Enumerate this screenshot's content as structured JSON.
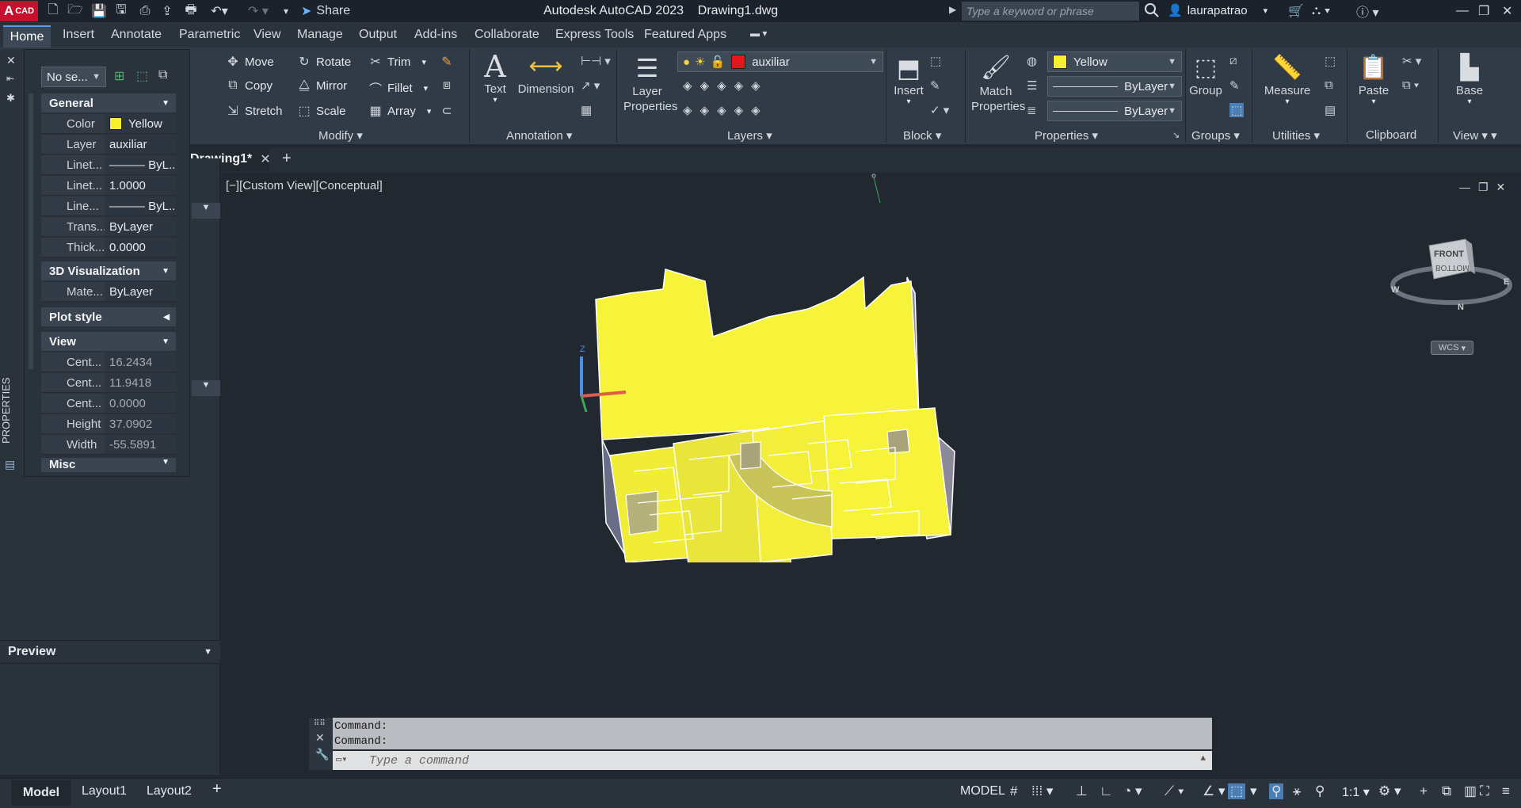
{
  "app": {
    "logo_letter": "A",
    "logo_text": "CAD",
    "title": "Autodesk AutoCAD 2023    Drawing1.dwg",
    "share_label": "Share",
    "search_placeholder": "Type a keyword or phrase",
    "username": "laurapatrao"
  },
  "ribbon_tabs": [
    "Home",
    "Insert",
    "Annotate",
    "Parametric",
    "View",
    "Manage",
    "Output",
    "Add-ins",
    "Collaborate",
    "Express Tools",
    "Featured Apps"
  ],
  "modify": {
    "move": "Move",
    "rotate": "Rotate",
    "trim": "Trim",
    "copy": "Copy",
    "mirror": "Mirror",
    "fillet": "Fillet",
    "stretch": "Stretch",
    "scale": "Scale",
    "array": "Array",
    "title": "Modify"
  },
  "annotation": {
    "text": "Text",
    "dimension": "Dimension",
    "title": "Annotation"
  },
  "layers": {
    "props_line1": "Layer",
    "props_line2": "Properties",
    "current_layer": "auxiliar",
    "layer_color": "#e8141b",
    "title": "Layers"
  },
  "block": {
    "insert": "Insert",
    "title": "Block"
  },
  "properties": {
    "match_line1": "Match",
    "match_line2": "Properties",
    "color_value": "Yellow",
    "color_hex": "#f6f12a",
    "linetype": "ByLayer",
    "lineweight": "ByLayer",
    "title": "Properties"
  },
  "groups": {
    "group": "Group",
    "title": "Groups"
  },
  "utilities": {
    "measure": "Measure",
    "title": "Utilities"
  },
  "clipboard": {
    "paste": "Paste",
    "title": "Clipboard"
  },
  "view_panel": {
    "base": "Base",
    "title": "View"
  },
  "doc_tab": "Drawing1*",
  "viewport_label": "[−][Custom View][Conceptual]",
  "viewcube": {
    "face_top": "FRONT",
    "face_bottom": "BOTTOM",
    "compass_w": "W",
    "compass_e": "E",
    "compass_n": "N",
    "wcs": "WCS"
  },
  "palette": {
    "selection": "No se...",
    "side_title": "PROPERTIES",
    "categories": {
      "general": "General",
      "viz": "3D Visualization",
      "plot": "Plot style",
      "view": "View",
      "misc": "Misc"
    },
    "general_rows": [
      {
        "k": "Color",
        "v": "Yellow"
      },
      {
        "k": "Layer",
        "v": "auxiliar"
      },
      {
        "k": "Linet...",
        "v": "——— ByL..."
      },
      {
        "k": "Linet...",
        "v": "1.0000"
      },
      {
        "k": "Line...",
        "v": "——— ByL..."
      },
      {
        "k": "Trans...",
        "v": "ByLayer"
      },
      {
        "k": "Thick...",
        "v": "0.0000"
      }
    ],
    "viz_rows": [
      {
        "k": "Mate...",
        "v": "ByLayer"
      }
    ],
    "view_rows": [
      {
        "k": "Cent...",
        "v": "16.2434"
      },
      {
        "k": "Cent...",
        "v": "11.9418"
      },
      {
        "k": "Cent...",
        "v": "0.0000"
      },
      {
        "k": "Height",
        "v": "37.0902"
      },
      {
        "k": "Width",
        "v": "-55.5891"
      }
    ],
    "preview": "Preview"
  },
  "command": {
    "history": [
      "Command:",
      "Command:"
    ],
    "placeholder": "Type a command"
  },
  "status": {
    "tabs": [
      "Model",
      "Layout1",
      "Layout2"
    ],
    "mode": "MODEL",
    "scale": "1:1"
  }
}
